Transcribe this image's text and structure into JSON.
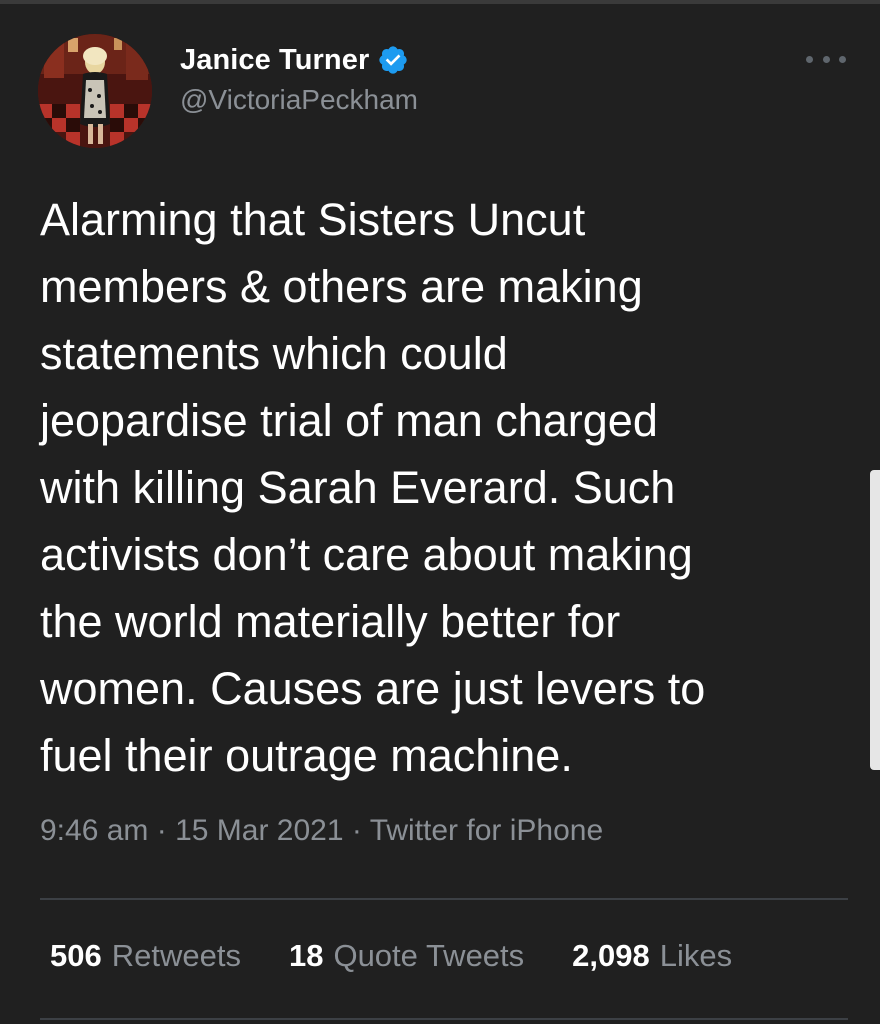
{
  "author": {
    "display_name": "Janice Turner",
    "handle": "@VictoriaPeckham",
    "verified": true
  },
  "tweet": {
    "text": "Alarming that Sisters Uncut\nmembers & others are making\nstatements which could\njeopardise trial of man charged\nwith killing Sarah Everard. Such\nactivists don’t care about making\nthe world materially better for\nwomen. Causes are just levers to\nfuel their outrage machine.",
    "time": "9:46 am",
    "date": "15 Mar 2021",
    "source": "Twitter for iPhone",
    "separator": "·"
  },
  "stats": {
    "retweets_count": "506",
    "retweets_label": "Retweets",
    "quote_tweets_count": "18",
    "quote_tweets_label": "Quote Tweets",
    "likes_count": "2,098",
    "likes_label": "Likes"
  },
  "icons": {
    "verified": "verified-badge-icon",
    "more": "more-options-icon"
  },
  "colors": {
    "background": "#202020",
    "text_primary": "#ffffff",
    "text_secondary": "#8b9096",
    "verified_blue": "#1d9bf0",
    "divider": "#3c4045"
  }
}
